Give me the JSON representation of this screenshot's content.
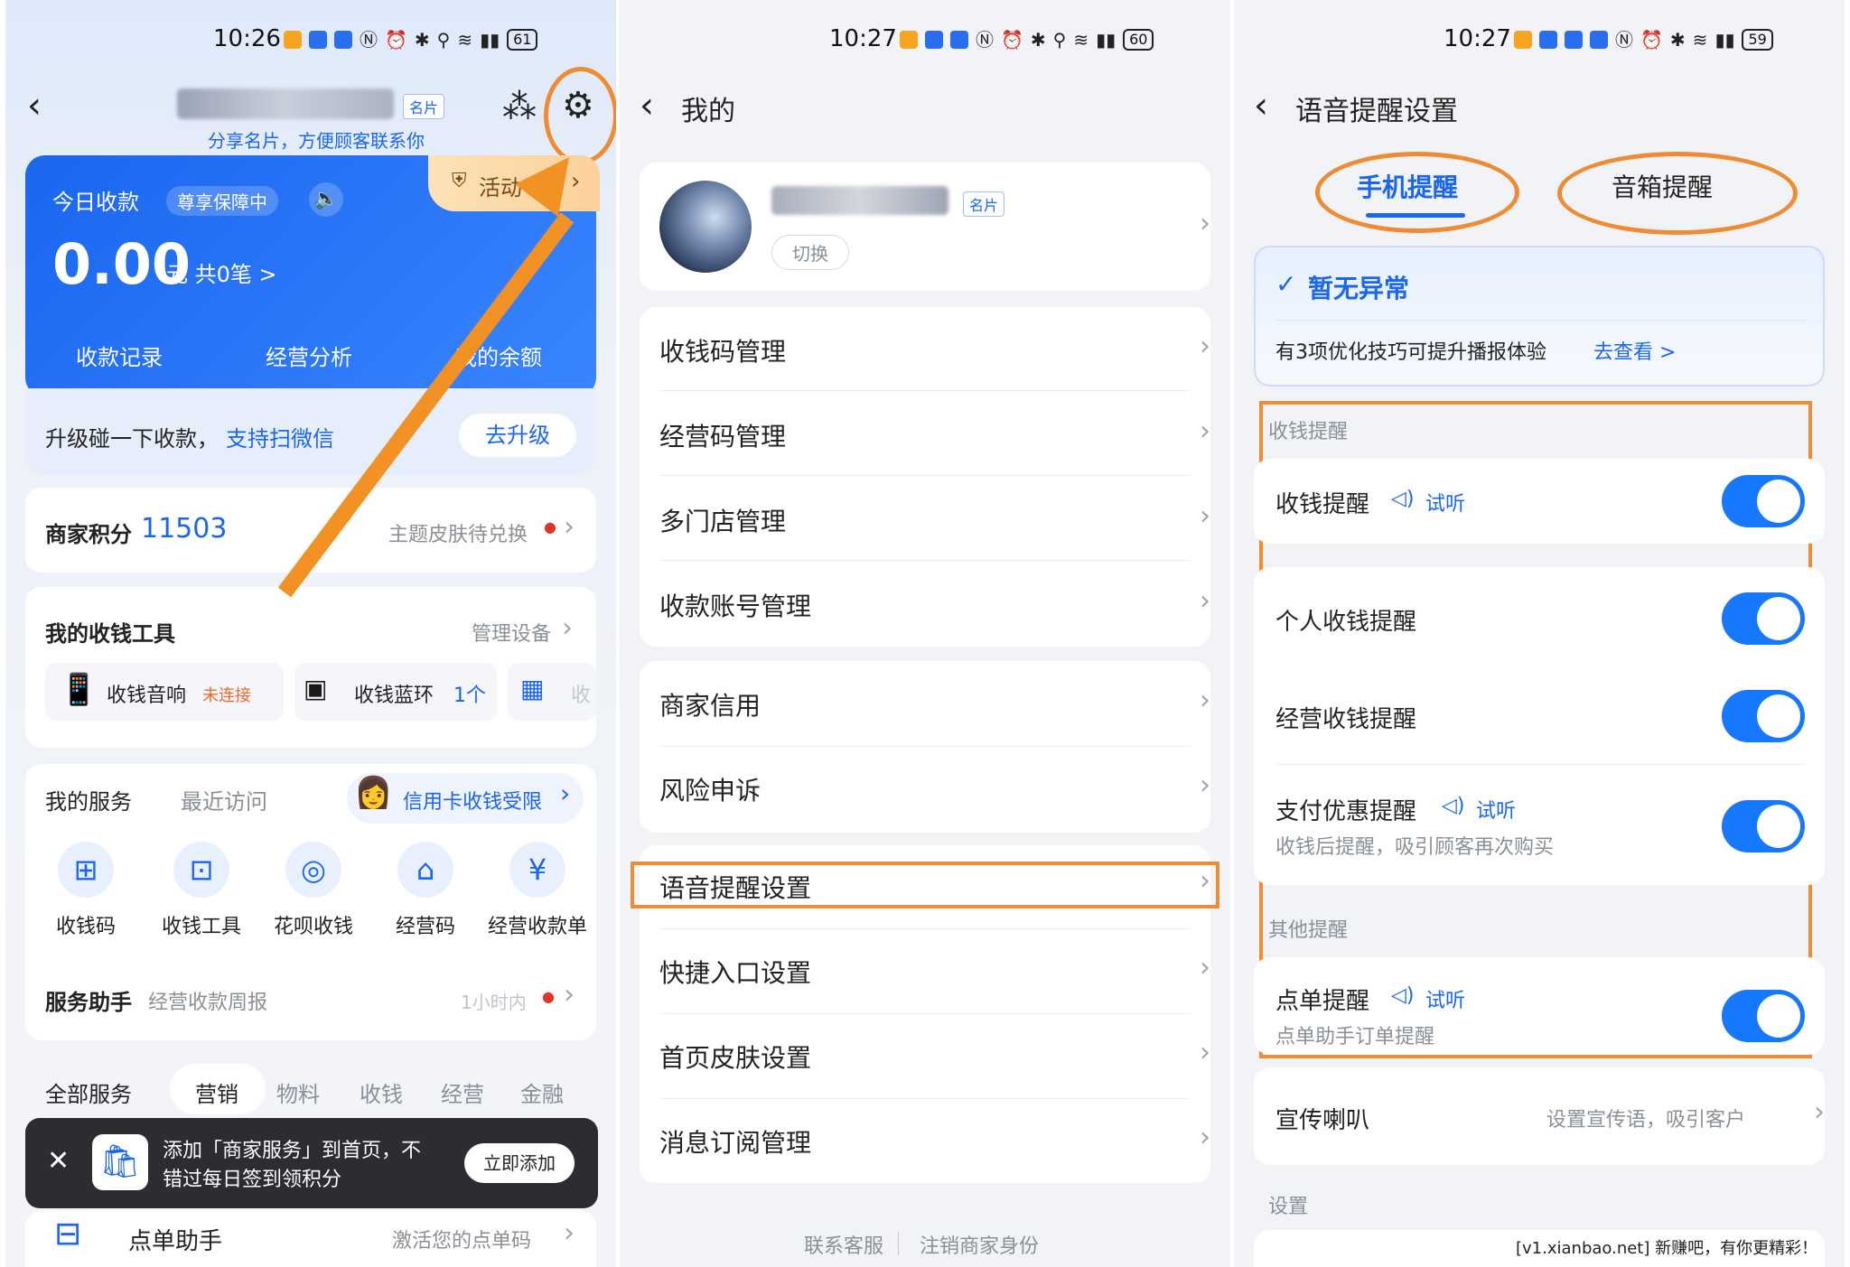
{
  "status": {
    "p1_time": "10:26",
    "p1_battery": "61",
    "p2_time": "10:27",
    "p2_battery": "60",
    "p3_time": "10:27",
    "p3_battery": "59"
  },
  "panel1": {
    "namecard_tag": "名片",
    "share_hint": "分享名片，方便顾客联系你",
    "today_label": "今日收款",
    "protect_badge": "尊享保障中",
    "event_label": "活动",
    "amount": "0.00",
    "amount_unit": "元 共0笔 >",
    "actions": [
      "收款记录",
      "经营分析",
      "我的余额"
    ],
    "upgrade_text": "升级碰一下收款，",
    "upgrade_link": "支持扫微信",
    "upgrade_btn": "去升级",
    "points_label": "商家积分",
    "points_value": "11503",
    "points_right": "主题皮肤待兑换",
    "tools_title": "我的收钱工具",
    "tools_manage": "管理设备",
    "tool1_name": "收钱音响",
    "tool1_status": "未连接",
    "tool2_name": "收钱蓝环",
    "tool2_count": "1个",
    "tool3_name": "收",
    "services_tab1": "我的服务",
    "services_tab2": "最近访问",
    "services_promo": "信用卡收钱受限",
    "services": [
      {
        "label": "收钱码",
        "icon": "qr-grid-icon"
      },
      {
        "label": "收钱工具",
        "icon": "cart-icon"
      },
      {
        "label": "花呗收钱",
        "icon": "huabei-icon"
      },
      {
        "label": "经营码",
        "icon": "store-icon"
      },
      {
        "label": "经营收款单",
        "icon": "receipt-icon"
      }
    ],
    "helper_label": "服务助手",
    "helper_sub": "经营收款周报",
    "helper_time": "1小时内",
    "all_services": "全部服务",
    "cat_tabs": [
      "营销",
      "物料",
      "收钱",
      "经营",
      "金融"
    ],
    "toast_line1": "添加「商家服务」到首页，不",
    "toast_line2": "错过每日签到领积分",
    "toast_btn": "立即添加",
    "order_label": "点单助手",
    "order_right": "激活您的点单码"
  },
  "panel2": {
    "title": "我的",
    "namecard_tag": "名片",
    "switch_label": "切换",
    "group1": [
      "收钱码管理",
      "经营码管理",
      "多门店管理",
      "收款账号管理"
    ],
    "group2": [
      "商家信用",
      "风险申诉"
    ],
    "group3": [
      "语音提醒设置",
      "快捷入口设置",
      "首页皮肤设置",
      "消息订阅管理"
    ],
    "footer_left": "联系客服",
    "footer_right": "注销商家身份"
  },
  "panel3": {
    "title": "语音提醒设置",
    "tab_phone": "手机提醒",
    "tab_speaker": "音箱提醒",
    "status_ok": "暂无异常",
    "tip_text": "有3项优化技巧可提升播报体验",
    "tip_link": "去查看 >",
    "section1": "收钱提醒",
    "row_collect": "收钱提醒",
    "listen": "试听",
    "row_personal": "个人收钱提醒",
    "row_business": "经营收钱提醒",
    "row_discount": "支付优惠提醒",
    "row_discount_sub": "收钱后提醒，吸引顾客再次购买",
    "section2": "其他提醒",
    "row_order": "点单提醒",
    "row_order_sub": "点单助手订单提醒",
    "row_promo": "宣传喇叭",
    "row_promo_right": "设置宣传语，吸引客户",
    "section3": "设置",
    "watermark": "[v1.xianbao.net] 新赚吧，有你更精彩！"
  }
}
